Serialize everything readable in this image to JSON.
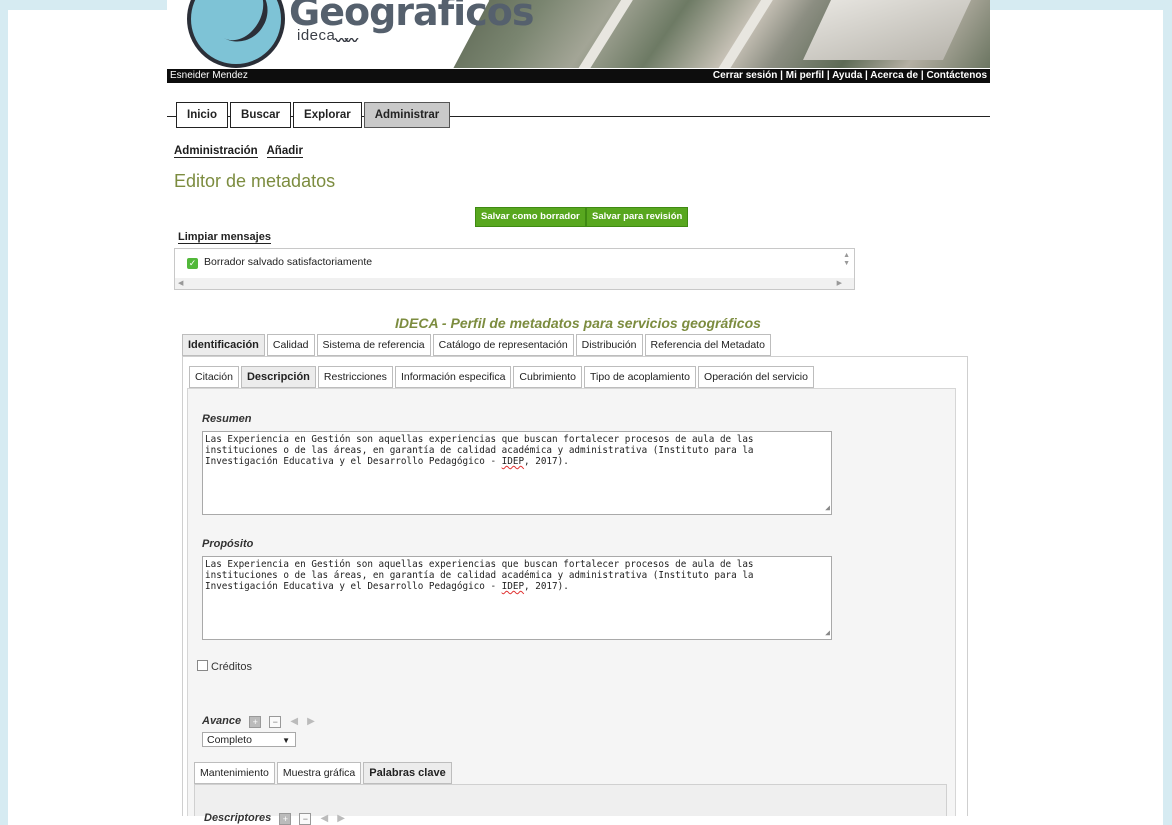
{
  "header": {
    "logo_title": "Geograficos",
    "logo_subtitle": "ideca",
    "user_name": "Esneider Mendez",
    "links": [
      "Cerrar sesión",
      "Mi perfil",
      "Ayuda",
      "Acerca de",
      "Contáctenos"
    ]
  },
  "main_nav": [
    "Inicio",
    "Buscar",
    "Explorar",
    "Administrar"
  ],
  "main_nav_active": "Administrar",
  "breadcrumb": [
    "Administración",
    "Añadir"
  ],
  "page_title": "Editor de metadatos",
  "buttons": {
    "save_draft": "Salvar como borrador",
    "save_review": "Salvar para revisión"
  },
  "messages": {
    "clear_label": "Limpiar mensajes",
    "items": [
      "Borrador salvado satisfactoriamente"
    ]
  },
  "profile_title": "IDECA - Perfil de metadatos para servicios geográficos",
  "section_tabs": [
    "Identificación",
    "Calidad",
    "Sistema de referencia",
    "Catálogo de representación",
    "Distribución",
    "Referencia del Metadato"
  ],
  "section_tabs_active": "Identificación",
  "sub_tabs": [
    "Citación",
    "Descripción",
    "Restricciones",
    "Información especifica",
    "Cubrimiento",
    "Tipo de acoplamiento",
    "Operación del servicio"
  ],
  "sub_tabs_active": "Descripción",
  "form": {
    "resumen_label": "Resumen",
    "resumen_lines": [
      "Las Experiencia en Gestión son aquellas experiencias que buscan fortalecer procesos de aula de las",
      "instituciones o de las áreas, en garantía de calidad académica y administrativa (Instituto para la",
      "Investigación Educativa y el Desarrollo Pedagógico - ",
      "IDEP",
      ", 2017)."
    ],
    "proposito_label": "Propósito",
    "proposito_lines": [
      "Las Experiencia en Gestión son aquellas experiencias que buscan fortalecer procesos de aula de las",
      "instituciones o de las áreas, en garantía de calidad académica y administrativa (Instituto para la",
      "Investigación Educativa y el Desarrollo Pedagógico - ",
      "IDEP",
      ", 2017)."
    ],
    "creditos_label": "Créditos",
    "avance_label": "Avance",
    "avance_value": "Completo",
    "descriptores_label": "Descriptores"
  },
  "inner_tabs": [
    "Mantenimiento",
    "Muestra gráfica",
    "Palabras clave"
  ],
  "inner_tabs_active": "Palabras clave",
  "colors": {
    "accent_green": "#58a71f",
    "title_olive": "#7c8c3f",
    "page_bg": "#d6ebf2"
  }
}
